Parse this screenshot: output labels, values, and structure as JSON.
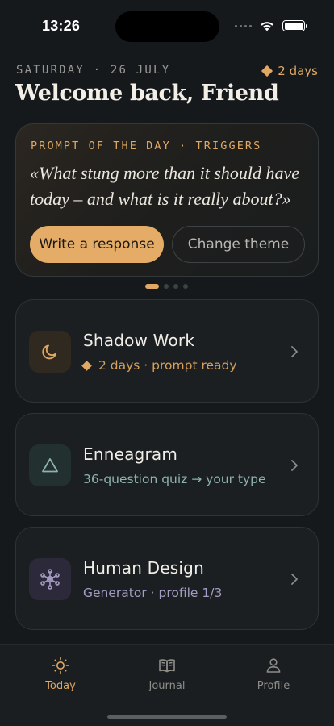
{
  "status": {
    "time": "13:26"
  },
  "header": {
    "date": "SATURDAY · 26 JULY",
    "streak": "2 days",
    "greeting": "Welcome back, Friend"
  },
  "prompt_card": {
    "eyebrow": "PROMPT OF THE DAY · TRIGGERS",
    "text": "«What stung more than it should have today – and what is it really about?»",
    "primary_label": "Write a response",
    "secondary_label": "Change theme",
    "pager": {
      "count": 4,
      "active": 1
    }
  },
  "modules": [
    {
      "title": "Shadow Work",
      "subtitle": "2 days · prompt ready",
      "icon": "moon-icon"
    },
    {
      "title": "Enneagram",
      "subtitle": "36-question quiz → your type",
      "icon": "triangle-icon"
    },
    {
      "title": "Human Design",
      "subtitle": "Generator · profile 1/3",
      "icon": "network-icon"
    }
  ],
  "tabs": [
    {
      "label": "Today",
      "icon": "sun-icon",
      "active": true
    },
    {
      "label": "Journal",
      "icon": "book-icon",
      "active": false
    },
    {
      "label": "Profile",
      "icon": "person-icon",
      "active": false
    }
  ],
  "colors": {
    "accent": "#e0a862",
    "background": "#15191b",
    "card": "#1b1f21",
    "enneagram": "#8eb2b1",
    "human_design": "#a59cc4"
  }
}
